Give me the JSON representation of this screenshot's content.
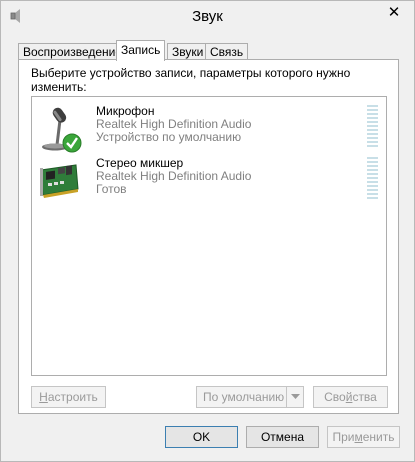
{
  "window": {
    "title": "Звук",
    "close_glyph": "✕"
  },
  "tabs": [
    {
      "label": "Воспроизведение",
      "active": false
    },
    {
      "label": "Запись",
      "active": true
    },
    {
      "label": "Звуки",
      "active": false
    },
    {
      "label": "Связь",
      "active": false
    }
  ],
  "panel": {
    "instruction": "Выберите устройство записи, параметры которого нужно изменить:"
  },
  "devices": [
    {
      "name": "Микрофон",
      "driver": "Realtek High Definition Audio",
      "status": "Устройство по умолчанию",
      "icon": "microphone-icon",
      "is_default": true,
      "level": 0
    },
    {
      "name": "Стерео микшер",
      "driver": "Realtek High Definition Audio",
      "status": "Готов",
      "icon": "sound-card-icon",
      "is_default": false,
      "level": 0
    }
  ],
  "panel_buttons": {
    "configure_pre": "Н",
    "configure_rest": "астроить",
    "set_default": "По умолчанию",
    "properties_pre": "Сво",
    "properties_ul": "й",
    "properties_rest": "ства"
  },
  "dialog_buttons": {
    "ok": "OK",
    "cancel": "Отмена",
    "apply_pre": "При",
    "apply_ul": "м",
    "apply_rest": "енить"
  },
  "colors": {
    "meter_inactive": "#c8dfe7",
    "check_green": "#3aa63a",
    "default_button_border": "#3c7fb1"
  }
}
